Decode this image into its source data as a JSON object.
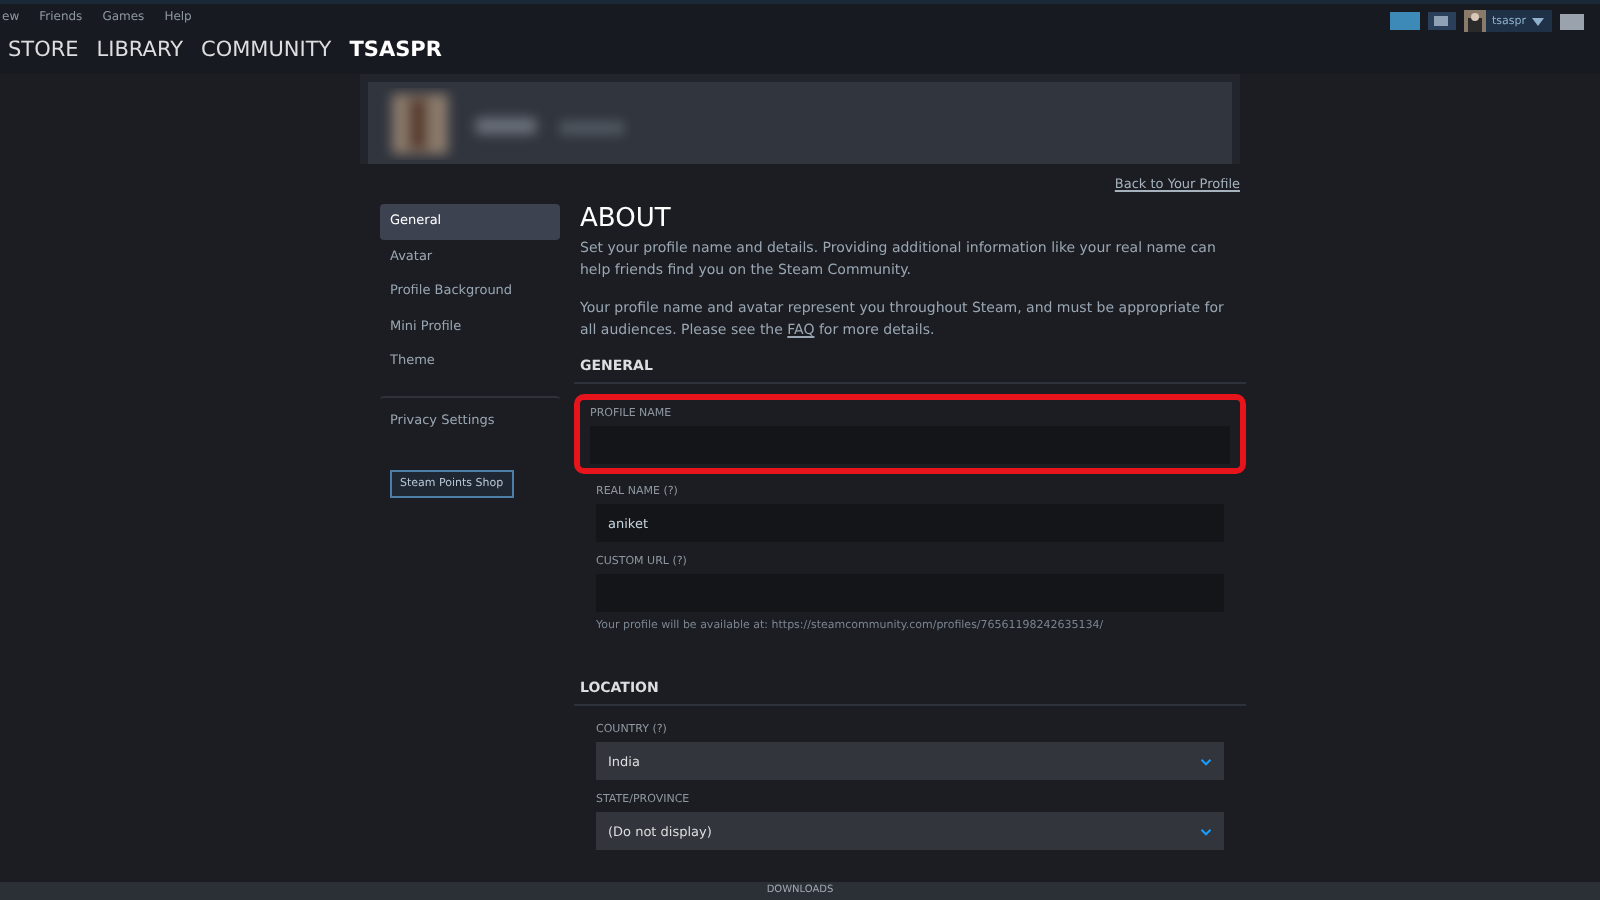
{
  "menu": [
    "ew",
    "Friends",
    "Games",
    "Help"
  ],
  "nav": [
    {
      "label": "STORE",
      "selected": false
    },
    {
      "label": "LIBRARY",
      "selected": false
    },
    {
      "label": "COMMUNITY",
      "selected": false
    },
    {
      "label": "TSASPR",
      "selected": true
    }
  ],
  "account": {
    "username": "tsaspr"
  },
  "sidebar": {
    "items": [
      {
        "label": "General",
        "selected": true
      },
      {
        "label": "Avatar",
        "selected": false
      },
      {
        "label": "Profile Background",
        "selected": false
      },
      {
        "label": "Mini Profile",
        "selected": false
      },
      {
        "label": "Theme",
        "selected": false
      },
      {
        "label": "Privacy Settings",
        "selected": false
      }
    ],
    "shop_button": "Steam Points Shop"
  },
  "back_link": "Back to Your Profile",
  "title": "ABOUT",
  "intro": "Set your profile name and details. Providing additional information like your real name can help friends find you on the Steam Community.",
  "notice": {
    "before": "Your profile name and avatar represent you throughout Steam, and must be appropriate for all audiences. Please see the ",
    "link": "FAQ",
    "after": " for more details."
  },
  "sections": [
    {
      "heading": "GENERAL",
      "fields": [
        {
          "kind": "text",
          "label": "PROFILE NAME",
          "highlighted": true
        },
        {
          "kind": "text",
          "label": "REAL NAME (?)",
          "value": "aniket",
          "highlighted": false
        },
        {
          "kind": "text",
          "label": "CUSTOM URL (?)",
          "highlighted": false,
          "hint": "Your profile will be available at: https://steamcommunity.com/profiles/76561198242635134/"
        }
      ]
    },
    {
      "heading": "LOCATION",
      "fields": [
        {
          "kind": "select",
          "label": "COUNTRY (?)",
          "value": "India",
          "highlighted": false
        },
        {
          "kind": "select",
          "label": "STATE/PROVINCE",
          "value": "(Do not display)",
          "highlighted": false
        }
      ]
    }
  ],
  "bottom_bar": "DOWNLOADS"
}
